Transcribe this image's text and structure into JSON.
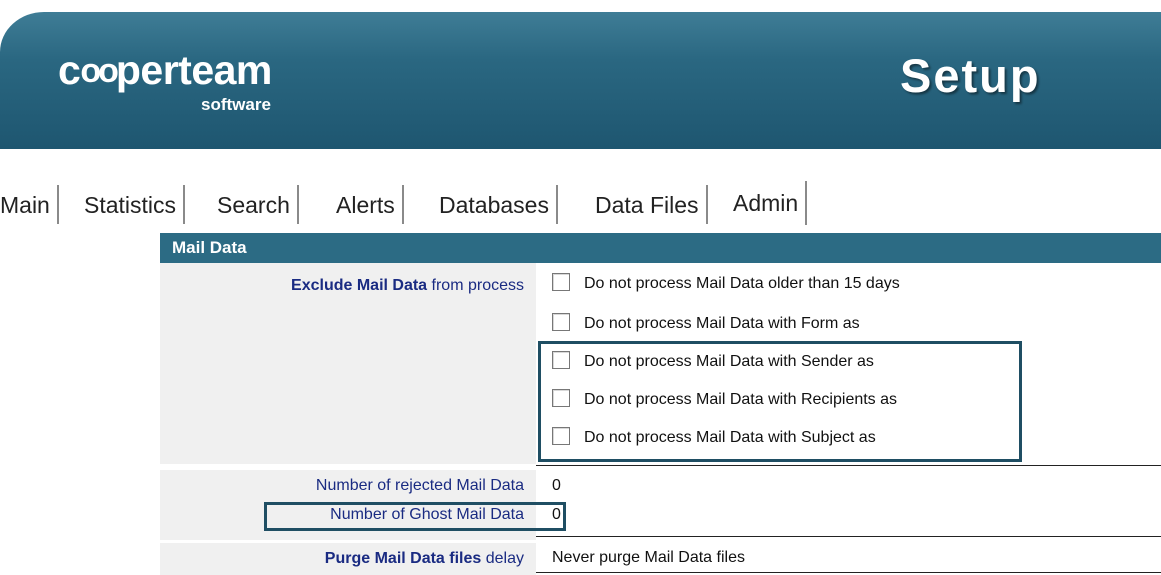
{
  "header": {
    "logo_main_a": "c",
    "logo_main_oo": "oo",
    "logo_main_b": "perteam",
    "logo_sub": "software",
    "title": "Setup"
  },
  "tabs": [
    {
      "label": "Main"
    },
    {
      "label": "Statistics"
    },
    {
      "label": "Search"
    },
    {
      "label": "Alerts"
    },
    {
      "label": "Databases"
    },
    {
      "label": "Data Files"
    },
    {
      "label": "Admin",
      "active": true
    }
  ],
  "section": {
    "title": "Mail Data",
    "exclude": {
      "label_bold": "Exclude Mail Data",
      "label_rest": " from process",
      "options": [
        {
          "label": "Do not process Mail Data older than  15 days",
          "checked": false
        },
        {
          "label": "Do not process Mail Data with Form as",
          "checked": false
        },
        {
          "label": "Do not process Mail Data with Sender as",
          "checked": false
        },
        {
          "label": "Do not process Mail Data with Recipients as",
          "checked": false
        },
        {
          "label": "Do not process Mail Data with Subject as",
          "checked": false
        }
      ]
    },
    "rejected": {
      "label": "Number of rejected Mail Data",
      "value": "0"
    },
    "ghost": {
      "label": "Number of Ghost Mail Data",
      "value": "0"
    },
    "purge": {
      "label_bold": "Purge Mail Data files",
      "label_rest": " delay",
      "value": "Never purge Mail Data files"
    }
  },
  "colors": {
    "header_bg": "#2a6781",
    "section_header_bg": "#2c6b84",
    "label_text": "#1a2b82",
    "highlight_border": "#1f4e63"
  }
}
